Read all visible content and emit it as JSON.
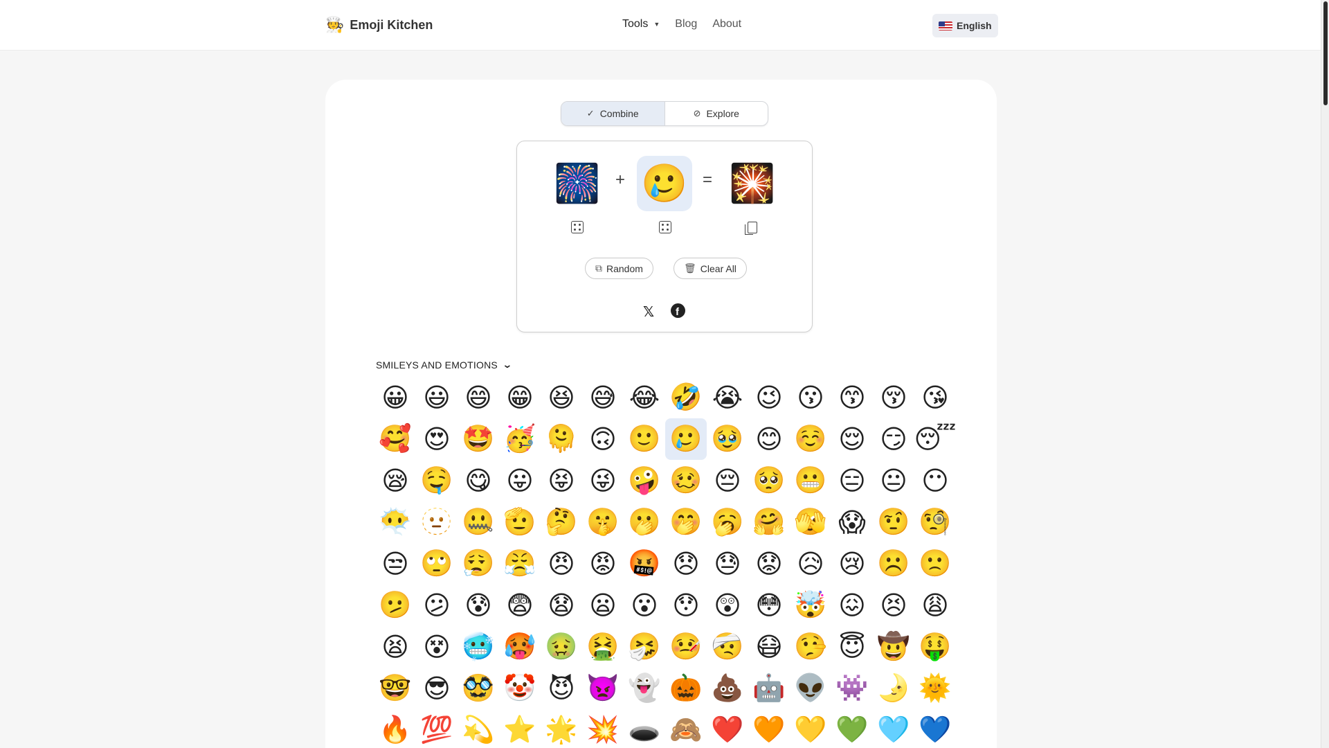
{
  "header": {
    "brand": "Emoji Kitchen",
    "brand_logo": "🧑‍🍳",
    "nav": {
      "tools": "Tools",
      "blog": "Blog",
      "about": "About"
    },
    "language": "English"
  },
  "mode_toggle": {
    "combine": "Combine",
    "explore": "Explore",
    "active": "Combine"
  },
  "combiner": {
    "left": "🎆",
    "right": "🥲",
    "plus": "+",
    "equals": "=",
    "result": "🎇",
    "random_label": "Random",
    "clear_label": "Clear All",
    "share_x": "𝕏"
  },
  "category": {
    "title": "SMILEYS AND EMOTIONS"
  },
  "selected_index": 21,
  "emojis": [
    "😀",
    "😃",
    "😄",
    "😁",
    "😆",
    "😅",
    "😂",
    "🤣",
    "😭",
    "😉",
    "😗",
    "😙",
    "😚",
    "😘",
    "🥰",
    "😍",
    "🤩",
    "🥳",
    "🫠",
    "🙃",
    "🙂",
    "🥲",
    "🥹",
    "😊",
    "☺️",
    "😌",
    "😏",
    "😴",
    "😪",
    "🤤",
    "😋",
    "😛",
    "😝",
    "😜",
    "🤪",
    "🥴",
    "😔",
    "🥺",
    "😬",
    "😑",
    "😐",
    "😶",
    "😶‍🌫️",
    "🫥",
    "🤐",
    "🫡",
    "🤔",
    "🤫",
    "🫢",
    "🤭",
    "🥱",
    "🤗",
    "🫣",
    "😱",
    "🤨",
    "🧐",
    "😒",
    "🙄",
    "😮‍💨",
    "😤",
    "😠",
    "😡",
    "🤬",
    "😞",
    "😓",
    "😟",
    "😥",
    "😢",
    "☹️",
    "🙁",
    "🫤",
    "😕",
    "😰",
    "😨",
    "😧",
    "😦",
    "😮",
    "😯",
    "😲",
    "😳",
    "🤯",
    "😖",
    "😣",
    "😩",
    "😫",
    "😵",
    "🥶",
    "🥵",
    "🤢",
    "🤮",
    "🤧",
    "🤒",
    "🤕",
    "😷",
    "🤥",
    "😇",
    "🤠",
    "🤑",
    "🤓",
    "😎",
    "🥸",
    "🤡",
    "😈",
    "👿",
    "👻",
    "🎃",
    "💩",
    "🤖",
    "👽",
    "👾",
    "🌛",
    "🌞",
    "🔥",
    "💯",
    "💫",
    "⭐",
    "🌟",
    "💥",
    "🕳️",
    "🙈",
    "❤️",
    "🧡",
    "💛",
    "💚",
    "🩵",
    "💙"
  ]
}
